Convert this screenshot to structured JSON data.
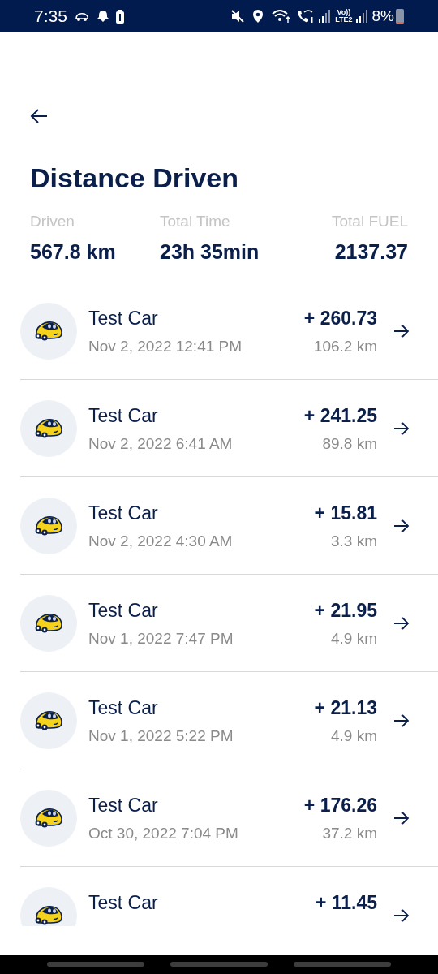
{
  "status_bar": {
    "time": "7:35",
    "network_label_top": "Vo))",
    "network_label_bottom": "LTE2",
    "battery_percent": "8%"
  },
  "title": "Distance Driven",
  "stats": [
    {
      "label": "Driven",
      "value": "567.8 km"
    },
    {
      "label": "Total Time",
      "value": "23h 35min"
    },
    {
      "label": "Total FUEL",
      "value": "2137.37"
    }
  ],
  "trips": [
    {
      "name": "Test Car",
      "date": "Nov 2, 2022 12:41 PM",
      "amount": "+ 260.73",
      "distance": "106.2 km"
    },
    {
      "name": "Test Car",
      "date": "Nov 2, 2022 6:41 AM",
      "amount": "+ 241.25",
      "distance": "89.8 km"
    },
    {
      "name": "Test Car",
      "date": "Nov 2, 2022 4:30 AM",
      "amount": "+ 15.81",
      "distance": "3.3 km"
    },
    {
      "name": "Test Car",
      "date": "Nov 1, 2022 7:47 PM",
      "amount": "+ 21.95",
      "distance": "4.9 km"
    },
    {
      "name": "Test Car",
      "date": "Nov 1, 2022 5:22 PM",
      "amount": "+ 21.13",
      "distance": "4.9 km"
    },
    {
      "name": "Test Car",
      "date": "Oct 30, 2022 7:04 PM",
      "amount": "+ 176.26",
      "distance": "37.2 km"
    },
    {
      "name": "Test Car",
      "amount": "+ 11.45"
    }
  ]
}
